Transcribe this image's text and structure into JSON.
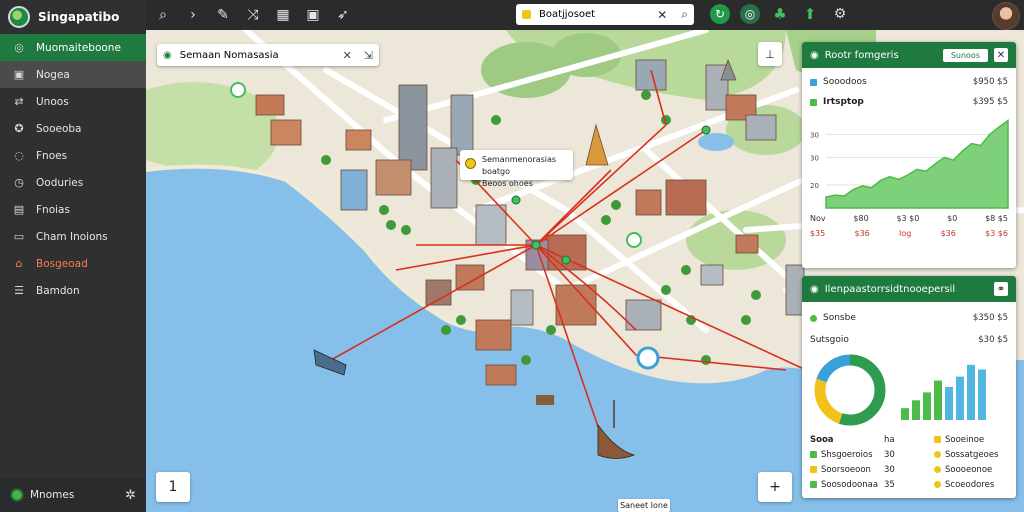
{
  "app": {
    "title": "Singapatibo"
  },
  "sidebar": {
    "items": [
      {
        "label": "Muomaiteboone",
        "icon": "circle-icon",
        "state": "active"
      },
      {
        "label": "Nogea",
        "icon": "folder-icon",
        "state": "hover"
      },
      {
        "label": "Unoos",
        "icon": "arrows-icon",
        "state": ""
      },
      {
        "label": "Sooeoba",
        "icon": "compass-icon",
        "state": ""
      },
      {
        "label": "Fnoes",
        "icon": "chat-icon",
        "state": ""
      },
      {
        "label": "Ooduries",
        "icon": "clock-icon",
        "state": ""
      },
      {
        "label": "Fnoias",
        "icon": "grid-icon",
        "state": ""
      },
      {
        "label": "Cham Inoions",
        "icon": "monitor-icon",
        "state": ""
      },
      {
        "label": "Bosgeoad",
        "icon": "home-icon",
        "state": "warn"
      },
      {
        "label": "Bamdon",
        "icon": "list-icon",
        "state": ""
      }
    ],
    "footer": {
      "label": "Mnomes"
    }
  },
  "toolbar": {
    "search_value": "Boatjjosoet",
    "tools": [
      "search-icon",
      "pointer-icon",
      "pen-icon",
      "shuffle-icon",
      "grid-icon",
      "bookmark-icon",
      "bird-icon"
    ]
  },
  "map": {
    "search_value": "Semaan Nomasasia",
    "popup": {
      "line1": "Semanmenorasias boatgo",
      "line2": "Beoos ohoes"
    },
    "zoom_left": "1",
    "zoom_right": "+",
    "scale_label": "Saneet Ione"
  },
  "panel1": {
    "title": "Rootr fomgeris",
    "button": "Sunoos",
    "row1": {
      "label": "Sooodoos",
      "value": "$950 $5"
    },
    "row2": {
      "label": "Irtsptop",
      "value": "$395 $5"
    },
    "chart_data": {
      "type": "area",
      "title": "",
      "yticks": [
        "30",
        "30",
        "20"
      ],
      "x": [
        0,
        1,
        2,
        3,
        4,
        5,
        6,
        7,
        8,
        9,
        10,
        11,
        12,
        13,
        14,
        15,
        16,
        17,
        18,
        19,
        20
      ],
      "values": [
        12,
        14,
        13,
        20,
        24,
        22,
        30,
        34,
        31,
        36,
        42,
        40,
        48,
        55,
        52,
        62,
        70,
        68,
        80,
        88,
        95
      ],
      "ylim": [
        0,
        100
      ],
      "color": "#4cbb47"
    },
    "xlabels": [
      "Nov",
      "$80",
      "$3 $0",
      "$0",
      "$8 $5"
    ],
    "bottom": [
      "$35",
      "$36",
      "Iog",
      "$36",
      "$3 $6"
    ]
  },
  "panel2": {
    "title": "Ilenpaastorrsidtnooepersil",
    "row1": {
      "label": "Sonsbe",
      "value": "$350 $5"
    },
    "row2": {
      "label": "Sutsgoio",
      "value": "$30 $5"
    },
    "donut": {
      "values": [
        55,
        25,
        20
      ],
      "colors": [
        "#2e9b4f",
        "#f2c21b",
        "#3aa0d8"
      ]
    },
    "bars": {
      "values": [
        15,
        25,
        35,
        50,
        42,
        55,
        70,
        64
      ],
      "colors": [
        "#4cbb47",
        "#4cbb47",
        "#4cbb47",
        "#4cbb47",
        "#52b7e0",
        "#52b7e0",
        "#52b7e0",
        "#52b7e0"
      ]
    },
    "legend_head": [
      "Sooa",
      "ha",
      "Sooeinoe"
    ],
    "legend": [
      {
        "a": "Shsgoeroios",
        "b": "30",
        "c": "Sossatgeoes",
        "ca": "#4cbb47",
        "cc": "#f2c21b"
      },
      {
        "a": "Soorsoeoon",
        "b": "30",
        "c": "Soooeonoe",
        "ca": "#f2c21b",
        "cc": "#f2c21b"
      },
      {
        "a": "Soosodoonaa",
        "b": "35",
        "c": "Scoeodores",
        "ca": "#4cbb47",
        "cc": "#f2c21b"
      }
    ]
  },
  "colors": {
    "accent": "#1f7a3f",
    "water": "#86bfe9",
    "route": "#d9301e",
    "park": "#a7d08a"
  }
}
